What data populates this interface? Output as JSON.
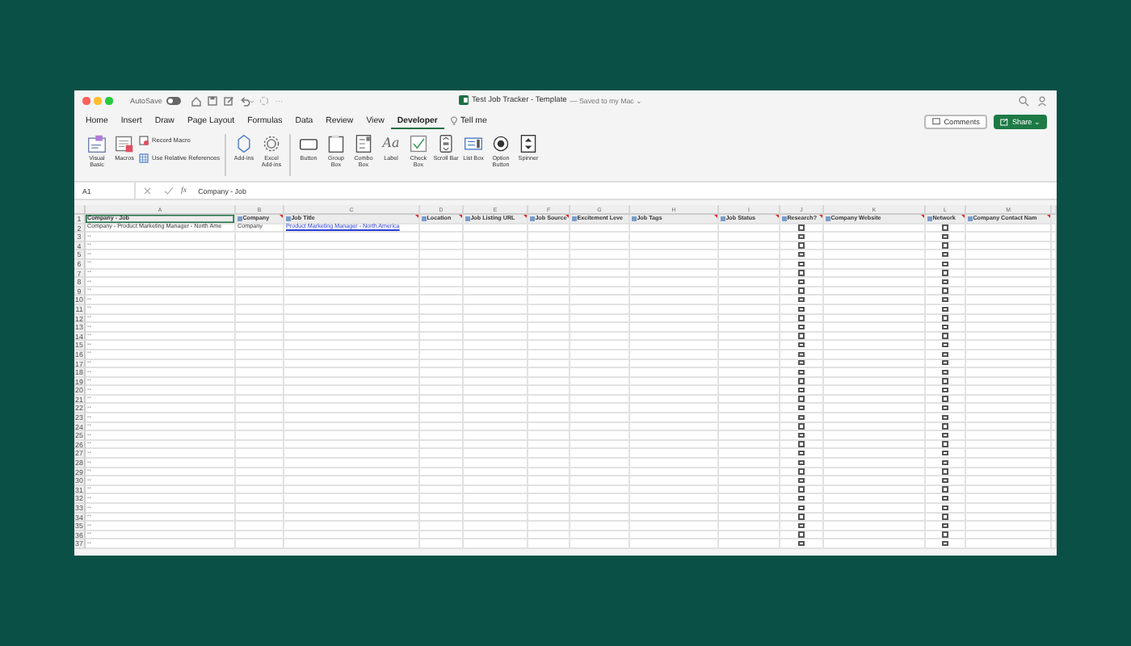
{
  "window": {
    "title": "Test Job Tracker - Template",
    "save_state": "— Saved to my Mac ⌄"
  },
  "quick_access": {
    "autosave_label": "AutoSave",
    "autosave_on": false,
    "more": "···"
  },
  "tabs": [
    {
      "label": "Home",
      "selected": false
    },
    {
      "label": "Insert",
      "selected": false
    },
    {
      "label": "Draw",
      "selected": false
    },
    {
      "label": "Page Layout",
      "selected": false
    },
    {
      "label": "Formulas",
      "selected": false
    },
    {
      "label": "Data",
      "selected": false
    },
    {
      "label": "Review",
      "selected": false
    },
    {
      "label": "View",
      "selected": false
    },
    {
      "label": "Developer",
      "selected": true
    },
    {
      "label": "Tell me",
      "selected": false
    }
  ],
  "actions": {
    "comments": "Comments",
    "share": "Share ⌄"
  },
  "ribbon": {
    "groups": [
      [
        {
          "kind": "vb",
          "label": "Visual Basic"
        },
        {
          "kind": "macros",
          "label": "Macros"
        },
        {
          "kind": "record",
          "label": "Record Macro"
        },
        {
          "kind": "relative",
          "label": "Use Relative References"
        }
      ],
      [
        {
          "kind": "addins",
          "label": "Add-ins"
        },
        {
          "kind": "gear",
          "label": "Excel Add-ins"
        }
      ],
      [
        {
          "kind": "button",
          "label": "Button"
        },
        {
          "kind": "groupbox",
          "label": "Group Box"
        },
        {
          "kind": "combobox",
          "label": "Combo Box"
        },
        {
          "kind": "label",
          "label": "Label",
          "glyph": "Aa"
        },
        {
          "kind": "checkbox",
          "label": "Check Box"
        },
        {
          "kind": "scrollbar",
          "label": "Scroll Bar"
        },
        {
          "kind": "listbox",
          "label": "List Box"
        },
        {
          "kind": "option",
          "label": "Option Button"
        },
        {
          "kind": "spinner",
          "label": "Spinner"
        }
      ]
    ]
  },
  "formula_bar": {
    "name_box": "A1",
    "fx": "fx",
    "value": "Company - Job"
  },
  "sheet": {
    "columns": [
      {
        "letter": "A",
        "header": "Company - Job",
        "icon": false,
        "comment": false,
        "selected": true
      },
      {
        "letter": "B",
        "header": "Company",
        "icon": true,
        "comment": true,
        "selected": false
      },
      {
        "letter": "C",
        "header": "Job Title",
        "icon": true,
        "comment": true,
        "selected": false
      },
      {
        "letter": "D",
        "header": "Location",
        "icon": true,
        "comment": true,
        "selected": false
      },
      {
        "letter": "E",
        "header": "Job Listing URL",
        "icon": true,
        "comment": true,
        "selected": false
      },
      {
        "letter": "F",
        "header": "Job Source",
        "icon": true,
        "comment": true,
        "selected": false
      },
      {
        "letter": "G",
        "header": "Excitement Leve",
        "icon": true,
        "comment": false,
        "selected": false
      },
      {
        "letter": "H",
        "header": "Job Tags",
        "icon": true,
        "comment": true,
        "selected": false
      },
      {
        "letter": "I",
        "header": "Job Status",
        "icon": true,
        "comment": true,
        "selected": false
      },
      {
        "letter": "J",
        "header": "Research?",
        "icon": true,
        "comment": true,
        "selected": false
      },
      {
        "letter": "K",
        "header": "Company Website",
        "icon": true,
        "comment": true,
        "selected": false
      },
      {
        "letter": "L",
        "header": "Network",
        "icon": true,
        "comment": true,
        "selected": false
      },
      {
        "letter": "M",
        "header": "Company Contact Nam",
        "icon": true,
        "comment": true,
        "selected": false
      }
    ],
    "header_row": "1",
    "rows": [
      {
        "number": "2",
        "cells": {
          "A": {
            "text": "Company - Product Marketing Manager - North Ame",
            "kind": "text"
          },
          "B": {
            "text": "Company",
            "kind": "text"
          },
          "C": {
            "text": "Product Marketing Manager - North America",
            "kind": "link"
          }
        },
        "checks": {
          "J": {
            "checked": false
          },
          "L": {
            "checked": false
          }
        }
      },
      {
        "number": "3",
        "cells": {
          "A": {
            "text": "--",
            "kind": "text"
          }
        },
        "checks": {
          "J": {
            "checked": false
          },
          "L": {
            "checked": false
          }
        }
      },
      {
        "number": "4",
        "cells": {
          "A": {
            "text": "--",
            "kind": "text"
          }
        },
        "checks": {
          "J": {
            "checked": false
          },
          "L": {
            "checked": false
          }
        }
      },
      {
        "number": "5",
        "cells": {
          "A": {
            "text": "--",
            "kind": "text"
          }
        },
        "checks": {
          "J": {
            "checked": false
          },
          "L": {
            "checked": false
          }
        }
      },
      {
        "number": "6",
        "cells": {
          "A": {
            "text": "--",
            "kind": "text"
          }
        },
        "checks": {
          "J": {
            "checked": false
          },
          "L": {
            "checked": false
          }
        }
      },
      {
        "number": "7",
        "cells": {
          "A": {
            "text": "--",
            "kind": "text"
          }
        },
        "checks": {
          "J": {
            "checked": false
          },
          "L": {
            "checked": false
          }
        }
      },
      {
        "number": "8",
        "cells": {
          "A": {
            "text": "--",
            "kind": "text"
          }
        },
        "checks": {
          "J": {
            "checked": false
          },
          "L": {
            "checked": false
          }
        }
      },
      {
        "number": "9",
        "cells": {
          "A": {
            "text": "--",
            "kind": "text"
          }
        },
        "checks": {
          "J": {
            "checked": false
          },
          "L": {
            "checked": false
          }
        }
      },
      {
        "number": "10",
        "cells": {
          "A": {
            "text": "--",
            "kind": "text"
          }
        },
        "checks": {
          "J": {
            "checked": false
          },
          "L": {
            "checked": false
          }
        }
      },
      {
        "number": "11",
        "cells": {
          "A": {
            "text": "--",
            "kind": "text"
          }
        },
        "checks": {
          "J": {
            "checked": false
          },
          "L": {
            "checked": false
          }
        }
      },
      {
        "number": "12",
        "cells": {
          "A": {
            "text": "--",
            "kind": "text"
          }
        },
        "checks": {
          "J": {
            "checked": false
          },
          "L": {
            "checked": false
          }
        }
      },
      {
        "number": "13",
        "cells": {
          "A": {
            "text": "--",
            "kind": "text"
          }
        },
        "checks": {
          "J": {
            "checked": false
          },
          "L": {
            "checked": false
          }
        }
      },
      {
        "number": "14",
        "cells": {
          "A": {
            "text": "--",
            "kind": "text"
          }
        },
        "checks": {
          "J": {
            "checked": false
          },
          "L": {
            "checked": false
          }
        }
      },
      {
        "number": "15",
        "cells": {
          "A": {
            "text": "--",
            "kind": "text"
          }
        },
        "checks": {
          "J": {
            "checked": false
          },
          "L": {
            "checked": false
          }
        }
      },
      {
        "number": "16",
        "cells": {
          "A": {
            "text": "--",
            "kind": "text"
          }
        },
        "checks": {
          "J": {
            "checked": false
          },
          "L": {
            "checked": false
          }
        }
      },
      {
        "number": "17",
        "cells": {
          "A": {
            "text": "--",
            "kind": "text"
          }
        },
        "checks": {
          "J": {
            "checked": false
          },
          "L": {
            "checked": false
          }
        }
      },
      {
        "number": "18",
        "cells": {
          "A": {
            "text": "--",
            "kind": "text"
          }
        },
        "checks": {
          "J": {
            "checked": false
          },
          "L": {
            "checked": false
          }
        }
      },
      {
        "number": "19",
        "cells": {
          "A": {
            "text": "--",
            "kind": "text"
          }
        },
        "checks": {
          "J": {
            "checked": false
          },
          "L": {
            "checked": false
          }
        }
      },
      {
        "number": "20",
        "cells": {
          "A": {
            "text": "--",
            "kind": "text"
          }
        },
        "checks": {
          "J": {
            "checked": false
          },
          "L": {
            "checked": false
          }
        }
      },
      {
        "number": "21",
        "cells": {
          "A": {
            "text": "--",
            "kind": "text"
          }
        },
        "checks": {
          "J": {
            "checked": false
          },
          "L": {
            "checked": false
          }
        }
      },
      {
        "number": "22",
        "cells": {
          "A": {
            "text": "--",
            "kind": "text"
          }
        },
        "checks": {
          "J": {
            "checked": false
          },
          "L": {
            "checked": false
          }
        }
      },
      {
        "number": "23",
        "cells": {
          "A": {
            "text": "--",
            "kind": "text"
          }
        },
        "checks": {
          "J": {
            "checked": false
          },
          "L": {
            "checked": false
          }
        }
      },
      {
        "number": "24",
        "cells": {
          "A": {
            "text": "--",
            "kind": "text"
          }
        },
        "checks": {
          "J": {
            "checked": false
          },
          "L": {
            "checked": false
          }
        }
      },
      {
        "number": "25",
        "cells": {
          "A": {
            "text": "--",
            "kind": "text"
          }
        },
        "checks": {
          "J": {
            "checked": false
          },
          "L": {
            "checked": false
          }
        }
      },
      {
        "number": "26",
        "cells": {
          "A": {
            "text": "--",
            "kind": "text"
          }
        },
        "checks": {
          "J": {
            "checked": false
          },
          "L": {
            "checked": false
          }
        }
      },
      {
        "number": "27",
        "cells": {
          "A": {
            "text": "--",
            "kind": "text"
          }
        },
        "checks": {
          "J": {
            "checked": false
          },
          "L": {
            "checked": false
          }
        }
      },
      {
        "number": "28",
        "cells": {
          "A": {
            "text": "--",
            "kind": "text"
          }
        },
        "checks": {
          "J": {
            "checked": false
          },
          "L": {
            "checked": false
          }
        }
      },
      {
        "number": "29",
        "cells": {
          "A": {
            "text": "--",
            "kind": "text"
          }
        },
        "checks": {
          "J": {
            "checked": false
          },
          "L": {
            "checked": false
          }
        }
      },
      {
        "number": "30",
        "cells": {
          "A": {
            "text": "--",
            "kind": "text"
          }
        },
        "checks": {
          "J": {
            "checked": false
          },
          "L": {
            "checked": false
          }
        }
      },
      {
        "number": "31",
        "cells": {
          "A": {
            "text": "--",
            "kind": "text"
          }
        },
        "checks": {
          "J": {
            "checked": false
          },
          "L": {
            "checked": false
          }
        }
      },
      {
        "number": "32",
        "cells": {
          "A": {
            "text": "--",
            "kind": "text"
          }
        },
        "checks": {
          "J": {
            "checked": false
          },
          "L": {
            "checked": false
          }
        }
      },
      {
        "number": "33",
        "cells": {
          "A": {
            "text": "--",
            "kind": "text"
          }
        },
        "checks": {
          "J": {
            "checked": false
          },
          "L": {
            "checked": false
          }
        }
      },
      {
        "number": "34",
        "cells": {
          "A": {
            "text": "--",
            "kind": "text"
          }
        },
        "checks": {
          "J": {
            "checked": false
          },
          "L": {
            "checked": false
          }
        }
      },
      {
        "number": "35",
        "cells": {
          "A": {
            "text": "--",
            "kind": "text"
          }
        },
        "checks": {
          "J": {
            "checked": false
          },
          "L": {
            "checked": false
          }
        }
      },
      {
        "number": "36",
        "cells": {
          "A": {
            "text": "--",
            "kind": "text"
          }
        },
        "checks": {
          "J": {
            "checked": false
          },
          "L": {
            "checked": false
          }
        }
      },
      {
        "number": "37",
        "cells": {
          "A": {
            "text": "--",
            "kind": "text"
          }
        },
        "checks": {
          "J": {
            "checked": false
          },
          "L": {
            "checked": false
          }
        }
      }
    ]
  }
}
